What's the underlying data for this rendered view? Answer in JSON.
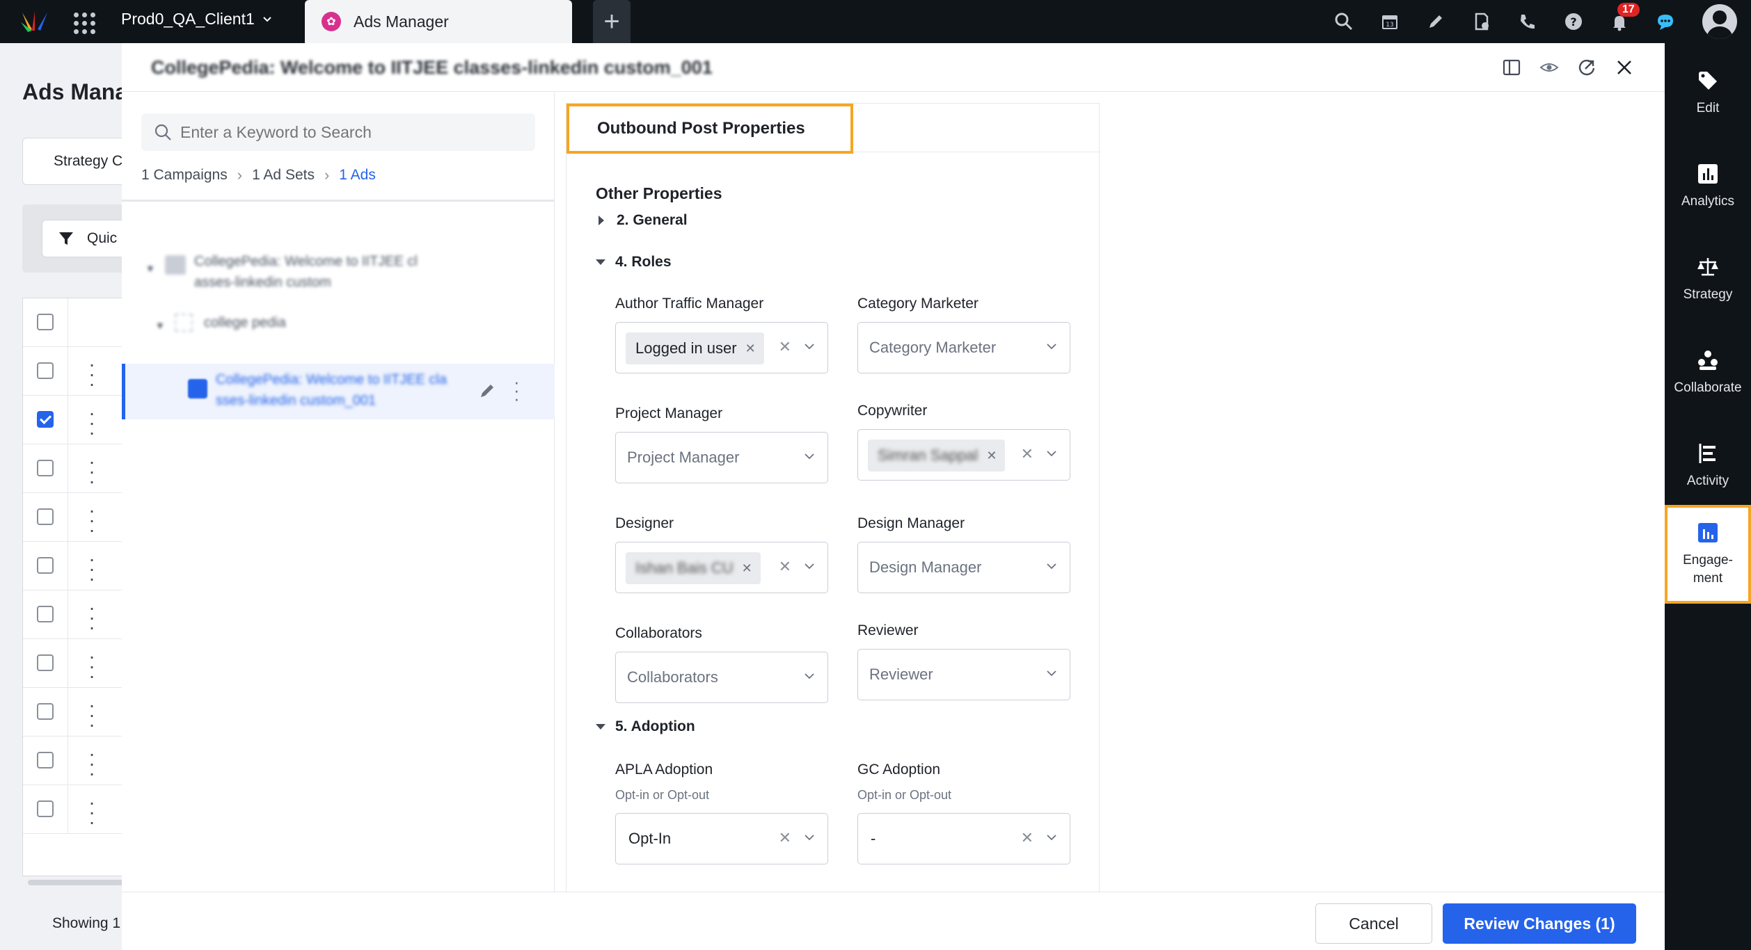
{
  "topbar": {
    "client_name": "Prod0_QA_Client1",
    "active_tab": "Ads Manager",
    "notification_count": "17",
    "icons": [
      "search-icon",
      "calendar-icon",
      "pencil-icon",
      "document-icon",
      "phone-icon",
      "help-icon",
      "bell-icon",
      "chat-icon",
      "avatar"
    ]
  },
  "background": {
    "page_title": "Ads Mana",
    "strategy_button": "Strategy C",
    "quick_filter": "Quic",
    "showing": "Showing 1"
  },
  "modal": {
    "title": "CollegePedia: Welcome to IITJEE classes-linkedin custom_001",
    "search": {
      "placeholder": "Enter a Keyword to Search"
    },
    "breadcrumbs": [
      "1 Campaigns",
      "1 Ad Sets",
      "1 Ads"
    ],
    "tree": {
      "campaign": "CollegePedia: Welcome to IITJEE cl asses-linkedin custom",
      "adset": "college pedia",
      "ad": "CollegePedia: Welcome to IITJEE cla sses-linkedin custom_001"
    },
    "form": {
      "tab_label": "Outbound Post Properties",
      "section_title": "Other Properties",
      "groups": {
        "general": "2. General",
        "roles": "4. Roles",
        "adoption": "5. Adoption"
      },
      "roles": {
        "author_traffic_manager": {
          "label": "Author Traffic Manager",
          "value": "Logged in user"
        },
        "category_marketer": {
          "label": "Category Marketer",
          "placeholder": "Category Marketer"
        },
        "project_manager": {
          "label": "Project Manager",
          "placeholder": "Project Manager"
        },
        "copywriter": {
          "label": "Copywriter",
          "value": "Simran Sappal"
        },
        "designer": {
          "label": "Designer",
          "value": "Ishan Bais CU"
        },
        "design_manager": {
          "label": "Design Manager",
          "placeholder": "Design Manager"
        },
        "collaborators": {
          "label": "Collaborators",
          "placeholder": "Collaborators"
        },
        "reviewer": {
          "label": "Reviewer",
          "placeholder": "Reviewer"
        }
      },
      "adoption": {
        "apla": {
          "label": "APLA Adoption",
          "sublabel": "Opt-in or Opt-out",
          "value": "Opt-In"
        },
        "gc": {
          "label": "GC Adoption",
          "sublabel": "Opt-in or Opt-out",
          "value": "-"
        }
      }
    },
    "footer": {
      "cancel": "Cancel",
      "review": "Review Changes (1)"
    }
  },
  "rail": {
    "items": [
      {
        "label": "Edit",
        "icon": "tag-icon"
      },
      {
        "label": "Analytics",
        "icon": "analytics-icon"
      },
      {
        "label": "Strategy",
        "icon": "scale-icon"
      },
      {
        "label": "Collaborate",
        "icon": "collaborate-icon"
      },
      {
        "label": "Activity",
        "icon": "activity-icon"
      },
      {
        "label": "Engage-\nment",
        "icon": "engagement-icon"
      }
    ]
  },
  "colors": {
    "accent": "#2563eb",
    "highlight": "#f5a623",
    "dark": "#0f1419"
  }
}
